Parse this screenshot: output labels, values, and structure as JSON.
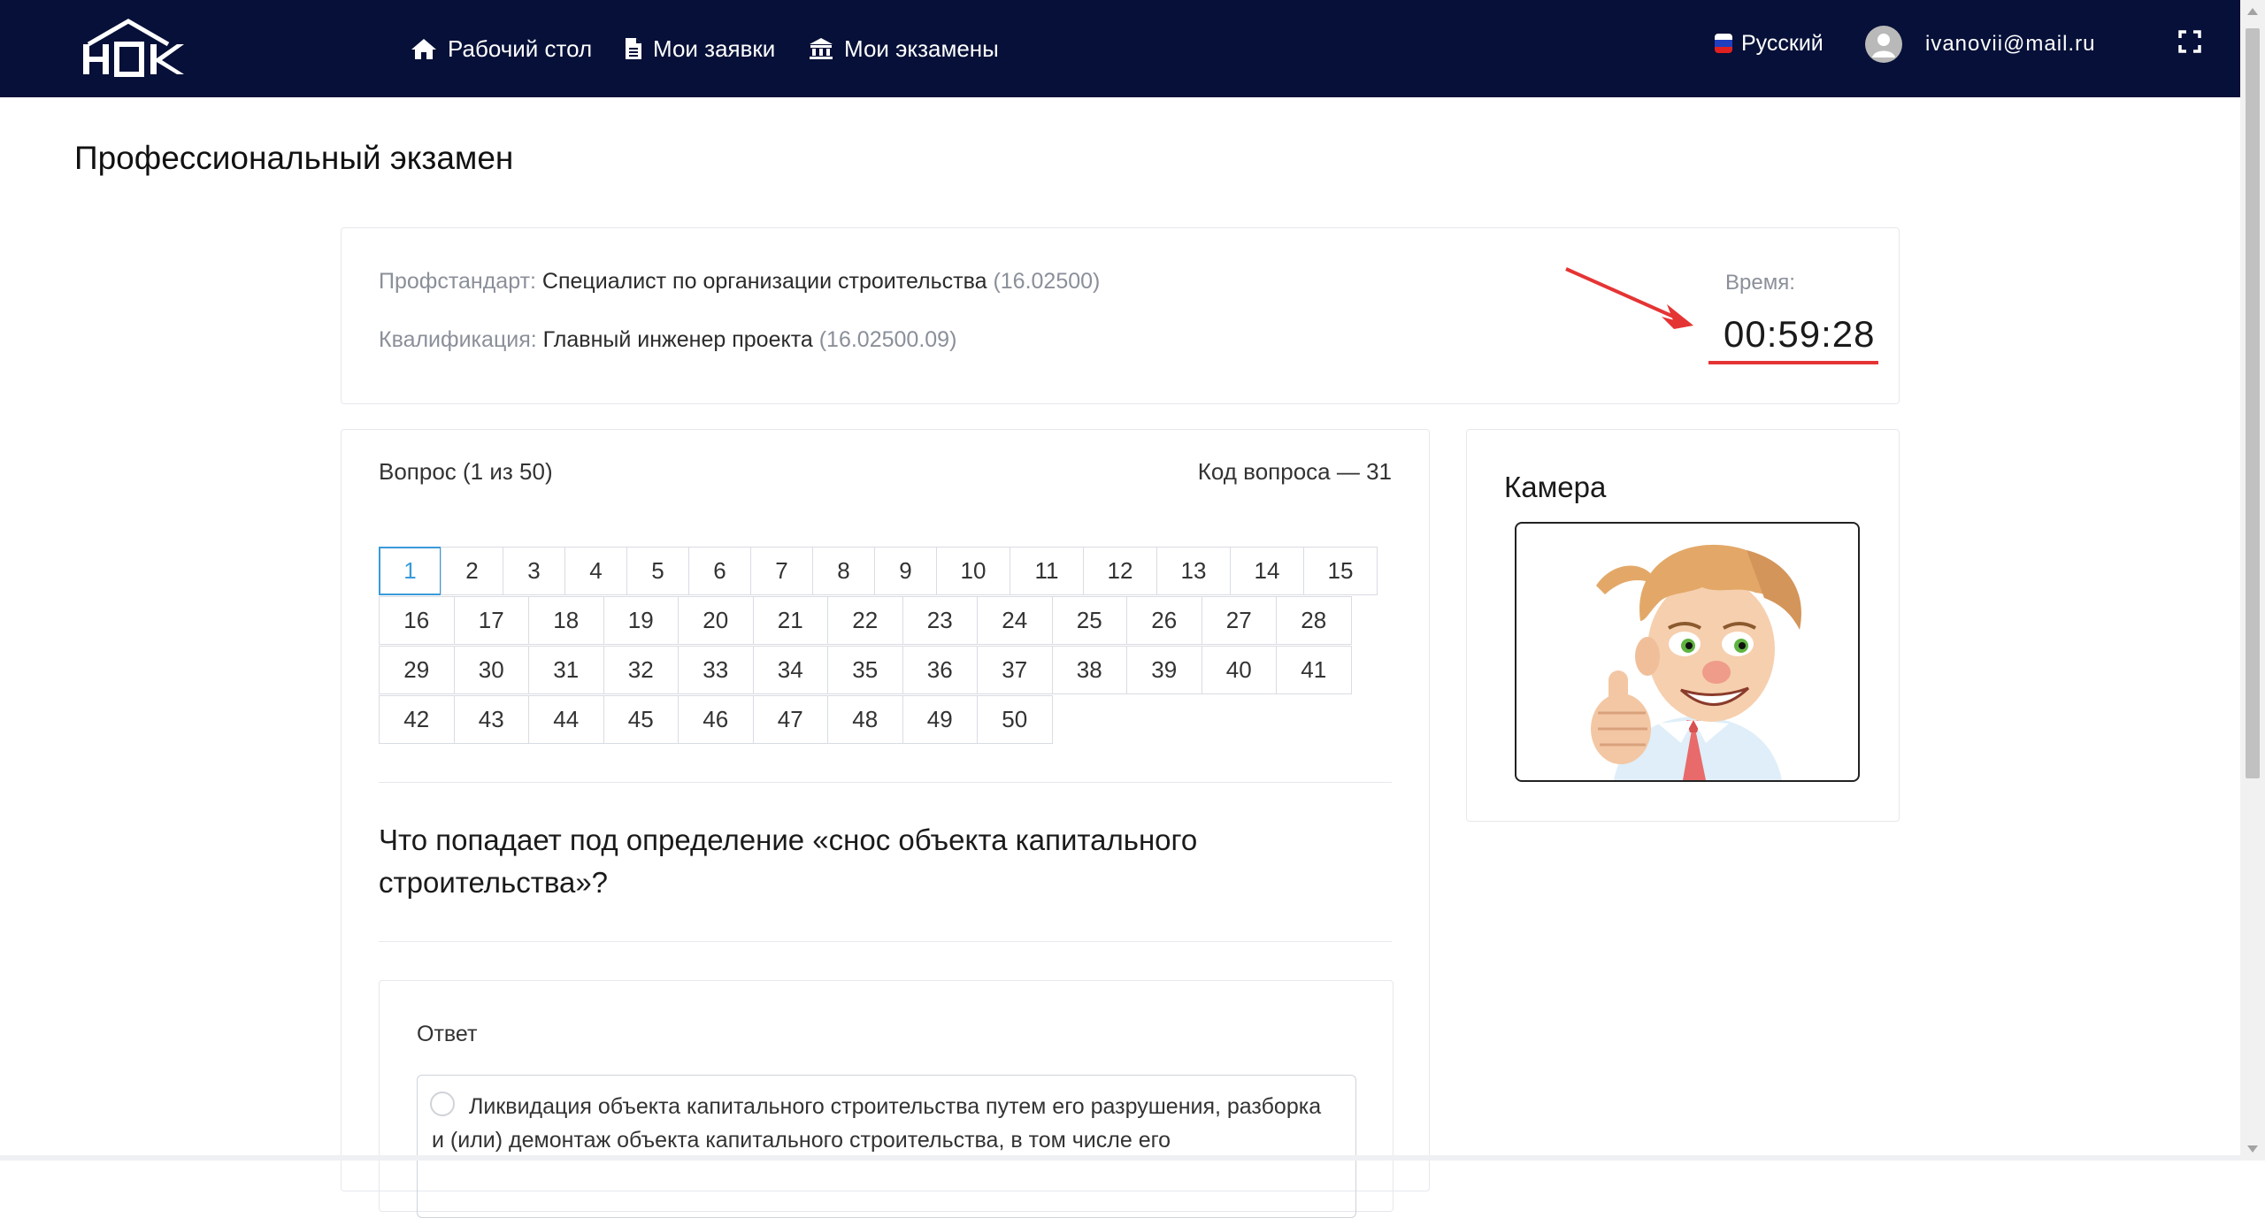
{
  "navbar": {
    "logo_text": "НОК",
    "items": [
      {
        "label": "Рабочий стол",
        "icon": "home-icon"
      },
      {
        "label": "Мои заявки",
        "icon": "document-icon"
      },
      {
        "label": "Мои экзамены",
        "icon": "institution-icon"
      }
    ],
    "language": "Русский",
    "user_email": "ivanovii@mail.ru"
  },
  "page": {
    "title": "Профессиональный экзамен"
  },
  "exam_info": {
    "standard_label": "Профстандарт:",
    "standard_name": "Специалист по организации строительства",
    "standard_code": "(16.02500)",
    "qualification_label": "Квалификация:",
    "qualification_name": "Главный инженер проекта",
    "qualification_code": "(16.02500.09)",
    "time_label": "Время:",
    "time_value": "00:59:28"
  },
  "question": {
    "counter": "Вопрос (1 из 50)",
    "code": "Код вопроса — 31",
    "numbers": [
      "1",
      "2",
      "3",
      "4",
      "5",
      "6",
      "7",
      "8",
      "9",
      "10",
      "11",
      "12",
      "13",
      "14",
      "15",
      "16",
      "17",
      "18",
      "19",
      "20",
      "21",
      "22",
      "23",
      "24",
      "25",
      "26",
      "27",
      "28",
      "29",
      "30",
      "31",
      "32",
      "33",
      "34",
      "35",
      "36",
      "37",
      "38",
      "39",
      "40",
      "41",
      "42",
      "43",
      "44",
      "45",
      "46",
      "47",
      "48",
      "49",
      "50"
    ],
    "active_number": "1",
    "text": "Что попадает под определение «снос объекта капитального строительства»?",
    "answer_label": "Ответ",
    "options": [
      {
        "text": "Ликвидация объекта капитального строительства путем его разрушения, разборка и (или) демонтаж объекта капитального строительства, в том числе его"
      }
    ]
  },
  "camera": {
    "title": "Камера"
  },
  "colors": {
    "navbar": "#061038",
    "active_cell": "#3a9ad9",
    "highlight": "#e53434"
  }
}
